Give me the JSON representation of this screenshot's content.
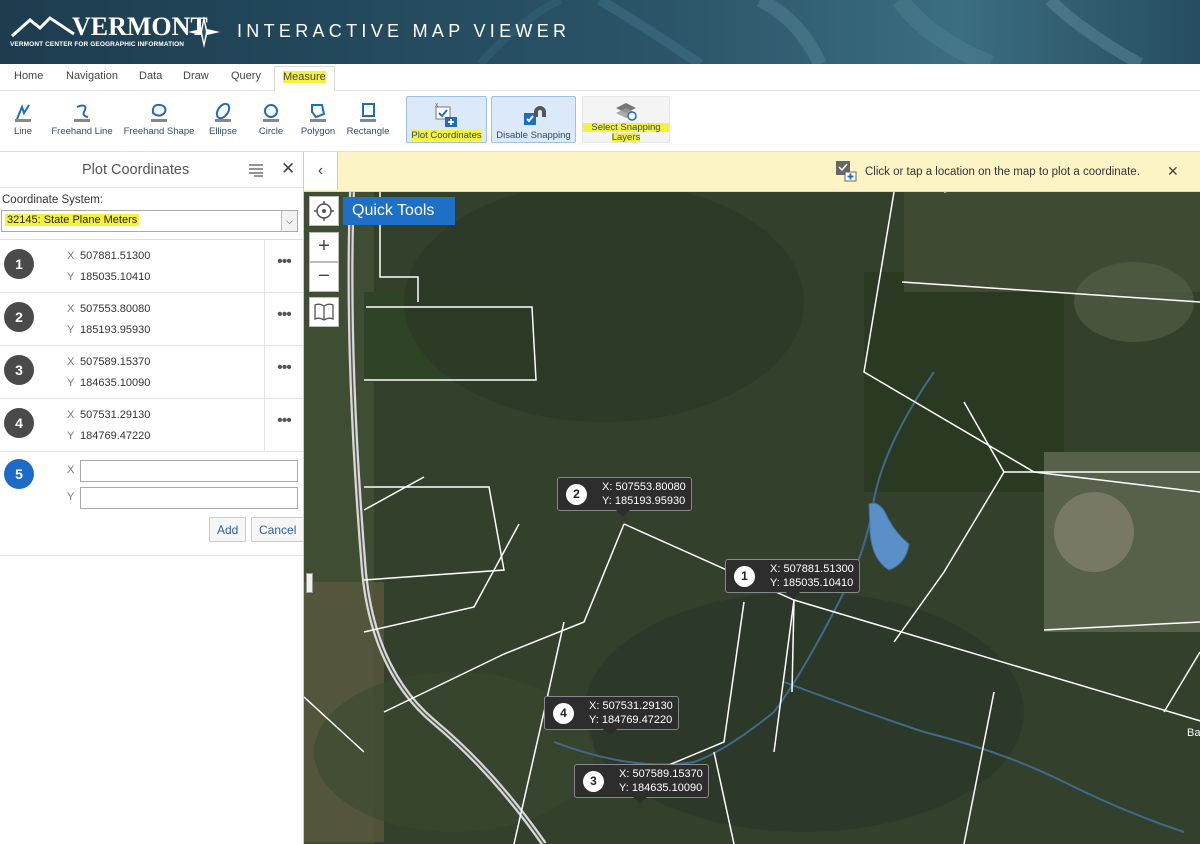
{
  "header": {
    "logo_word": "VERMONT",
    "logo_sub": "VERMONT CENTER FOR GEOGRAPHIC INFORMATION",
    "app_title": "INTERACTIVE MAP VIEWER"
  },
  "menu": {
    "tabs": [
      {
        "label": "Home"
      },
      {
        "label": "Navigation"
      },
      {
        "label": "Data"
      },
      {
        "label": "Draw"
      },
      {
        "label": "Query"
      },
      {
        "label": "Measure"
      }
    ]
  },
  "ribbon": {
    "tools": [
      {
        "label": "Line"
      },
      {
        "label": "Freehand Line"
      },
      {
        "label": "Freehand Shape"
      },
      {
        "label": "Ellipse"
      },
      {
        "label": "Circle"
      },
      {
        "label": "Polygon"
      },
      {
        "label": "Rectangle"
      }
    ],
    "plot_coordinates": "Plot Coordinates",
    "disable_snapping": "Disable Snapping",
    "select_snapping_1": "Select Snapping",
    "select_snapping_2": "Layers"
  },
  "panel": {
    "title": "Plot Coordinates",
    "coordinate_system_label": "Coordinate System:",
    "coordinate_system_value": "32145: State Plane Meters",
    "points": [
      {
        "n": "1",
        "x": "507881.51300",
        "y": "185035.10410"
      },
      {
        "n": "2",
        "x": "507553.80080",
        "y": "185193.95930"
      },
      {
        "n": "3",
        "x": "507589.15370",
        "y": "184635.10090"
      },
      {
        "n": "4",
        "x": "507531.29130",
        "y": "184769.47220"
      }
    ],
    "new_point_number": "5",
    "x_label": "X",
    "y_label": "Y",
    "add": "Add",
    "cancel": "Cancel"
  },
  "map": {
    "info_text": "Click or tap a location on the map to plot a coordinate.",
    "quick_tools": "Quick Tools",
    "edge_label": "Ba",
    "callouts": [
      {
        "n": "2",
        "x": "X: 507553.80080",
        "y": "Y: 185193.95930"
      },
      {
        "n": "1",
        "x": "X: 507881.51300",
        "y": "Y: 185035.10410"
      },
      {
        "n": "4",
        "x": "X: 507531.29130",
        "y": "Y: 184769.47220"
      },
      {
        "n": "3",
        "x": "X: 507589.15370",
        "y": "Y: 184635.10090"
      }
    ]
  },
  "colors": {
    "highlight": "#f6f23a",
    "accent_blue": "#1e6fc6"
  }
}
